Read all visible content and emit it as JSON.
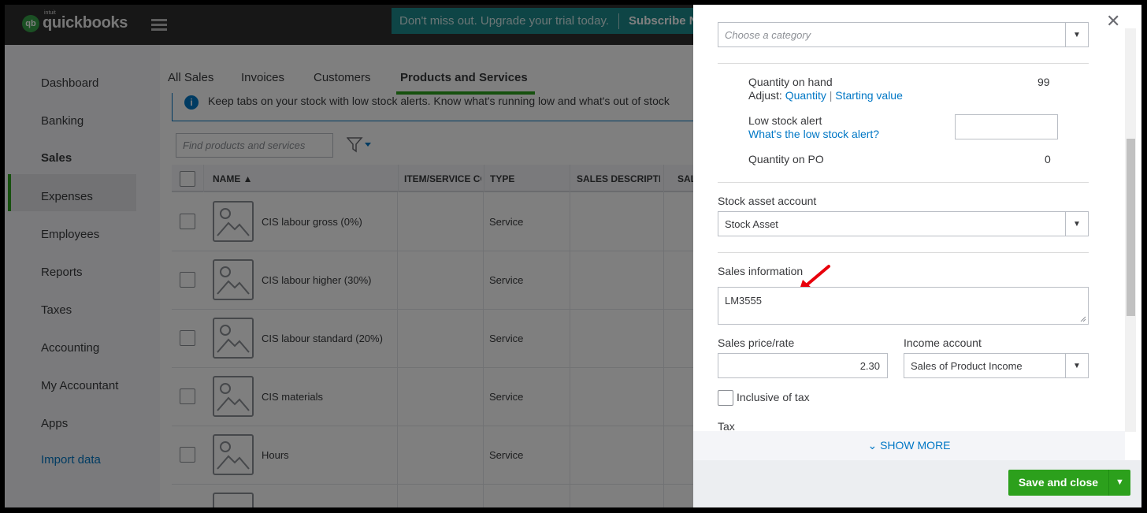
{
  "app": {
    "logo_small": "intuit",
    "logo_word": "quickbooks",
    "logo_mark": "qb"
  },
  "promo": {
    "text": "Don't miss out. Upgrade your trial today.",
    "subscribe": "Subscribe Now"
  },
  "sidebar": {
    "items": [
      {
        "label": "Dashboard"
      },
      {
        "label": "Banking"
      },
      {
        "label": "Sales",
        "active": true
      },
      {
        "label": "Expenses"
      },
      {
        "label": "Employees"
      },
      {
        "label": "Reports"
      },
      {
        "label": "Taxes"
      },
      {
        "label": "Accounting"
      },
      {
        "label": "My Accountant"
      },
      {
        "label": "Apps"
      },
      {
        "label": "Import data",
        "link": true
      }
    ]
  },
  "tabs": [
    {
      "label": "All Sales"
    },
    {
      "label": "Invoices"
    },
    {
      "label": "Customers"
    },
    {
      "label": "Products and Services",
      "active": true
    }
  ],
  "alert": {
    "text": "Keep tabs on your stock with low stock alerts. Know what's running low and what's out of stock"
  },
  "search": {
    "placeholder": "Find products and services"
  },
  "table": {
    "columns": [
      "NAME ▲",
      "ITEM/SERVICE CODE",
      "TYPE",
      "SALES DESCRIPTION",
      "SALES"
    ],
    "rows": [
      {
        "name": "CIS labour gross (0%)",
        "type": "Service"
      },
      {
        "name": "CIS labour higher (30%)",
        "type": "Service"
      },
      {
        "name": "CIS labour standard (20%)",
        "type": "Service"
      },
      {
        "name": "CIS materials",
        "type": "Service"
      },
      {
        "name": "Hours",
        "type": "Service"
      }
    ]
  },
  "panel": {
    "category_placeholder": "Choose a category",
    "qty_on_hand_label": "Quantity on hand",
    "qty_on_hand_value": "99",
    "adjust_label": "Adjust:",
    "adjust_quantity": "Quantity",
    "adjust_sep": "|",
    "adjust_starting": "Starting value",
    "low_stock_label": "Low stock alert",
    "low_stock_help": "What's the low stock alert?",
    "low_stock_value": "",
    "qty_po_label": "Quantity on PO",
    "qty_po_value": "0",
    "stock_asset_label": "Stock asset account",
    "stock_asset_value": "Stock Asset",
    "sales_info_label": "Sales information",
    "sales_info_value": "LM3555",
    "sales_price_label": "Sales price/rate",
    "sales_price_value": "2.30",
    "income_account_label": "Income account",
    "income_account_value": "Sales of Product Income",
    "inclusive_tax_label": "Inclusive of tax",
    "inclusive_tax_checked": false,
    "tax_label": "Tax",
    "show_more": "SHOW MORE",
    "save_close": "Save and close"
  },
  "colors": {
    "brand_green": "#2ca01c",
    "link_blue": "#0077c5",
    "promo_teal": "#1d8a8c",
    "arrow_red": "#e8000b"
  }
}
